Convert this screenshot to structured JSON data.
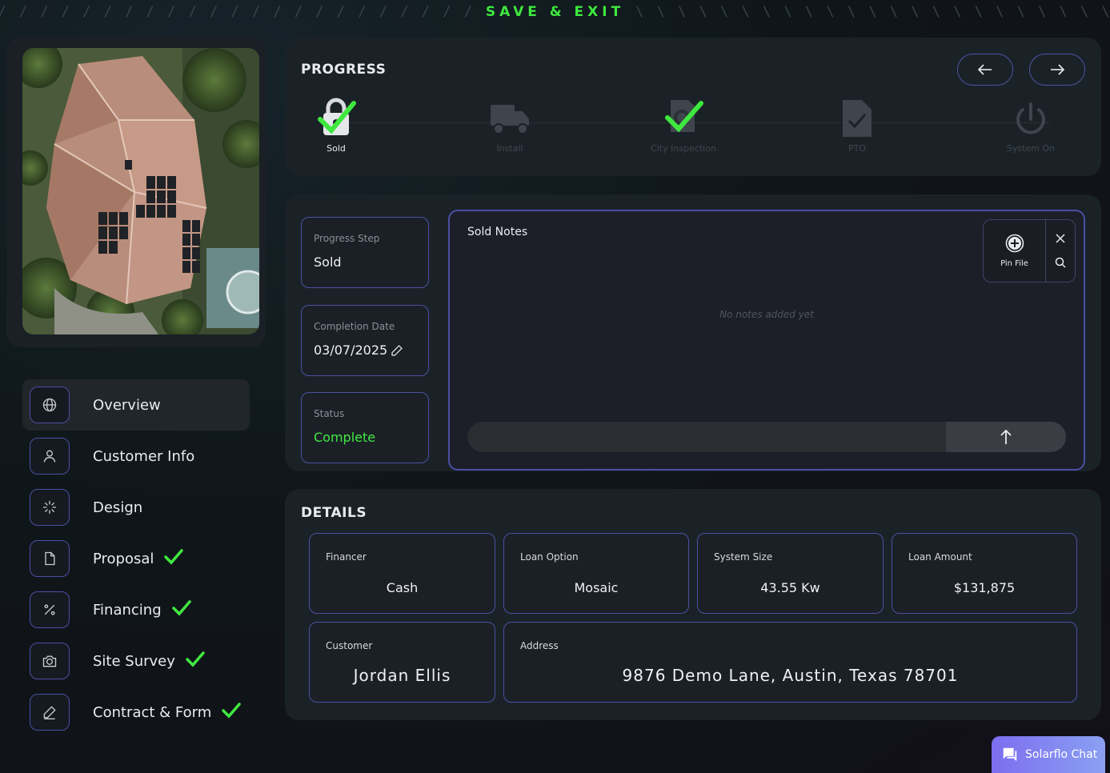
{
  "header": {
    "left_slashes": "/ / / / / / / / / / / / / / / / / / / / / / / / / / / / / / / / / / / / /",
    "save_exit_label": "SAVE & EXIT",
    "right_slashes": "\\ \\ \\ \\ \\ \\ \\ \\ \\ \\ \\ \\ \\ \\ \\ \\ \\ \\ \\ \\ \\ \\ \\ \\ \\ \\ \\ \\ \\ \\ \\ \\ \\ \\ \\ \\ \\"
  },
  "sidebar": {
    "items": [
      {
        "label": "Overview",
        "icon": "globe-icon",
        "active": true,
        "done": false
      },
      {
        "label": "Customer Info",
        "icon": "user-icon",
        "active": false,
        "done": false
      },
      {
        "label": "Design",
        "icon": "loader-icon",
        "active": false,
        "done": false
      },
      {
        "label": "Proposal",
        "icon": "file-icon",
        "active": false,
        "done": true
      },
      {
        "label": "Financing",
        "icon": "percent-icon",
        "active": false,
        "done": true
      },
      {
        "label": "Site Survey",
        "icon": "camera-icon",
        "active": false,
        "done": true
      },
      {
        "label": "Contract & Form",
        "icon": "pen-icon",
        "active": false,
        "done": true
      }
    ]
  },
  "progress": {
    "title": "PROGRESS",
    "steps": [
      {
        "label": "Sold",
        "icon": "lock-icon",
        "done": true
      },
      {
        "label": "Install",
        "icon": "truck-icon",
        "done": false
      },
      {
        "label": "City Inspection",
        "icon": "inspection-icon",
        "done": true
      },
      {
        "label": "PTO",
        "icon": "file-check-icon",
        "done": false
      },
      {
        "label": "System On",
        "icon": "power-icon",
        "done": false
      }
    ]
  },
  "overview": {
    "progress_step_label": "Progress Step",
    "progress_step_value": "Sold",
    "completion_date_label": "Completion Date",
    "completion_date_value": "03/07/2025",
    "status_label": "Status",
    "status_value": "Complete"
  },
  "notes": {
    "title": "Sold Notes",
    "empty_text": "No notes added yet",
    "pin_file_label": "Pin File",
    "input_value": ""
  },
  "details": {
    "title": "DETAILS",
    "financer_label": "Financer",
    "financer_value": "Cash",
    "loan_option_label": "Loan Option",
    "loan_option_value": "Mosaic",
    "system_size_label": "System Size",
    "system_size_value": "43.55 Kw",
    "loan_amount_label": "Loan Amount",
    "loan_amount_value": "$131,875",
    "customer_label": "Customer",
    "customer_value": "Jordan Ellis",
    "address_label": "Address",
    "address_value": "9876 Demo Lane, Austin, Texas 78701"
  },
  "chat": {
    "label": "Solarflo Chat"
  },
  "colors": {
    "accent_green": "#41e841",
    "border_purple": "#4c50a4",
    "chat_gradient_start": "#7c6ef0",
    "chat_gradient_end": "#8aa0f2"
  }
}
